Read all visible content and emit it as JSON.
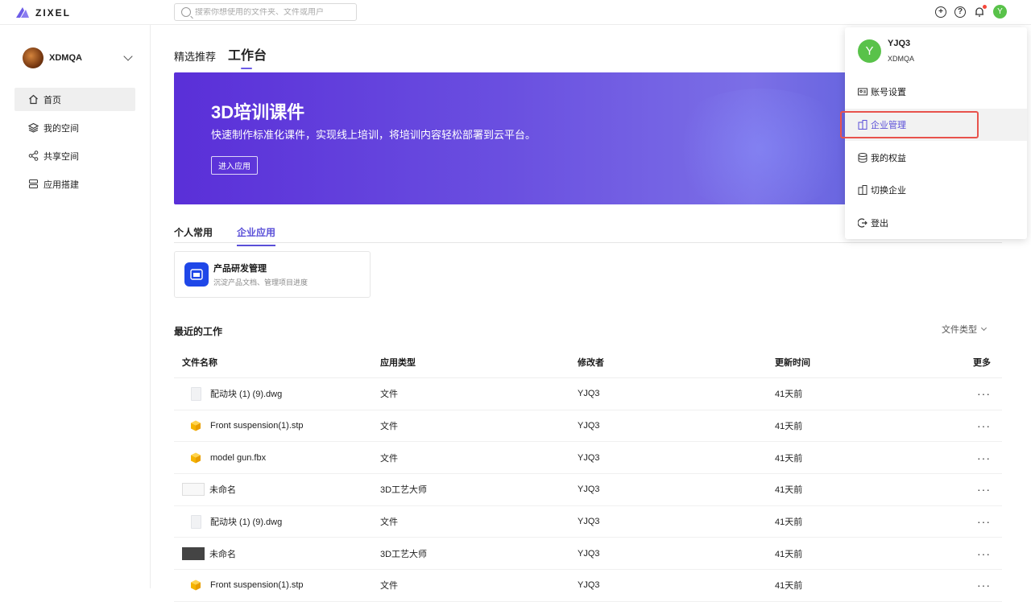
{
  "app": {
    "logo_text": "ZIXEL",
    "brand_color": "#6c5ce7"
  },
  "search": {
    "placeholder": "搜索你想使用的文件夹、文件或用户"
  },
  "topbar": {
    "icons": [
      "add-circle-icon",
      "help-icon",
      "bell-icon"
    ],
    "avatar_initial": "Y",
    "notification_dot_color": "#f5483b"
  },
  "sidebar": {
    "org_name": "XDMQA",
    "items": [
      {
        "label": "首页",
        "icon": "home-icon",
        "active": true
      },
      {
        "label": "我的空间",
        "icon": "layers-icon",
        "active": false
      },
      {
        "label": "共享空间",
        "icon": "share-icon",
        "active": false
      },
      {
        "label": "应用搭建",
        "icon": "build-icon",
        "active": false
      }
    ]
  },
  "main": {
    "tabs": [
      {
        "label": "精选推荐"
      },
      {
        "label": "工作台"
      }
    ],
    "banner": {
      "title": "3D培训课件",
      "subtitle": "快速制作标准化课件，实现线上培训，将培训内容轻松部署到云平台。",
      "button": "进入应用"
    },
    "app_tabs": [
      {
        "label": "个人常用"
      },
      {
        "label": "企业应用"
      }
    ],
    "app_card": {
      "title": "产品研发管理",
      "desc": "沉淀产品文档、管理项目进度"
    },
    "recent": {
      "title": "最近的工作",
      "filter_label": "文件类型",
      "columns": [
        "文件名称",
        "应用类型",
        "修改者",
        "更新时间",
        "更多"
      ],
      "rows": [
        {
          "name": "配动块 (1) (9).dwg",
          "type": "文件",
          "editor": "YJQ3",
          "time": "41天前",
          "icon": "doc"
        },
        {
          "name": "Front suspension(1).stp",
          "type": "文件",
          "editor": "YJQ3",
          "time": "41天前",
          "icon": "cube"
        },
        {
          "name": "model gun.fbx",
          "type": "文件",
          "editor": "YJQ3",
          "time": "41天前",
          "icon": "cube"
        },
        {
          "name": "未命名",
          "type": "3D工艺大师",
          "editor": "YJQ3",
          "time": "41天前",
          "icon": "thumb"
        },
        {
          "name": "配动块 (1) (9).dwg",
          "type": "文件",
          "editor": "YJQ3",
          "time": "41天前",
          "icon": "doc"
        },
        {
          "name": "未命名",
          "type": "3D工艺大师",
          "editor": "YJQ3",
          "time": "41天前",
          "icon": "thumb-dark"
        },
        {
          "name": "Front suspension(1).stp",
          "type": "文件",
          "editor": "YJQ3",
          "time": "41天前",
          "icon": "cube"
        }
      ],
      "more_glyph": "···"
    }
  },
  "user_menu": {
    "name": "YJQ3",
    "org": "XDMQA",
    "avatar_initial": "Y",
    "items": [
      {
        "label": "账号设置",
        "icon": "account-icon"
      },
      {
        "label": "企业管理",
        "icon": "building-icon",
        "highlighted": true
      },
      {
        "label": "我的权益",
        "icon": "database-icon"
      },
      {
        "label": "切换企业",
        "icon": "building-icon"
      },
      {
        "label": "登出",
        "icon": "logout-icon"
      }
    ],
    "highlight_color": "#e8534c"
  }
}
